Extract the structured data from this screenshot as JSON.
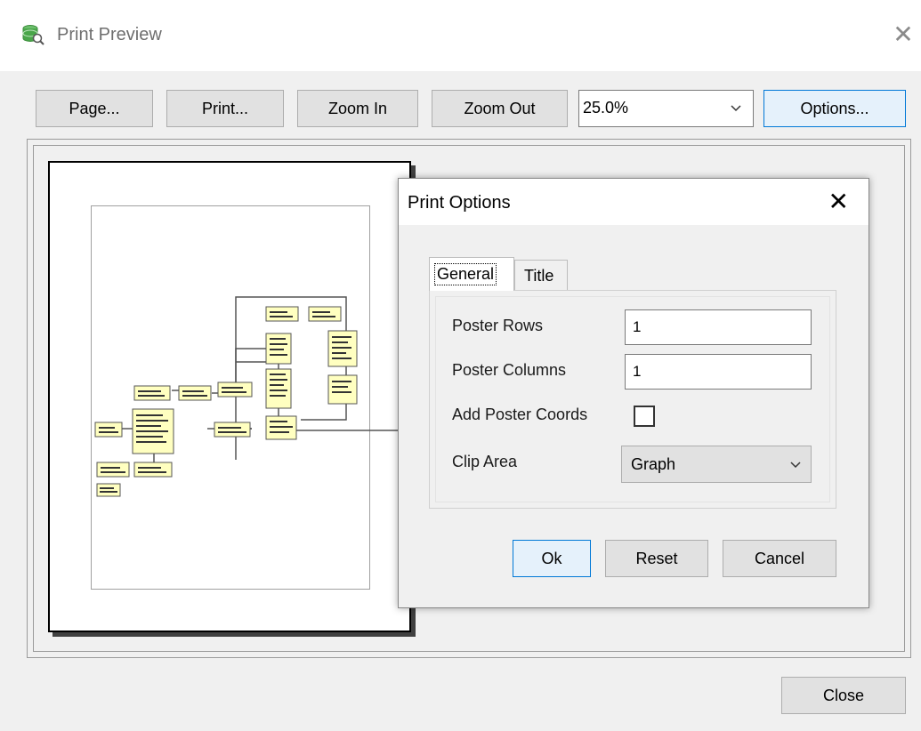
{
  "window": {
    "title": "Print Preview",
    "close_glyph": "✕"
  },
  "toolbar": {
    "page_label": "Page...",
    "print_label": "Print...",
    "zoom_in_label": "Zoom In",
    "zoom_out_label": "Zoom Out",
    "zoom_value": "25.0%",
    "options_label": "Options..."
  },
  "dialog": {
    "title": "Print Options",
    "close_glyph": "✕",
    "tabs": [
      {
        "label": "General",
        "active": true
      },
      {
        "label": "Title",
        "active": false
      }
    ],
    "fields": {
      "poster_rows_label": "Poster Rows",
      "poster_rows_value": "1",
      "poster_columns_label": "Poster Columns",
      "poster_columns_value": "1",
      "add_coords_label": "Add Poster Coords",
      "add_coords_checked": false,
      "clip_area_label": "Clip Area",
      "clip_area_value": "Graph"
    },
    "buttons": {
      "ok_label": "Ok",
      "reset_label": "Reset",
      "cancel_label": "Cancel"
    }
  },
  "footer": {
    "close_label": "Close"
  },
  "icons": {
    "app": "database-search-icon",
    "chevron": "chevron-down-icon"
  },
  "colors": {
    "accent": "#0078d7",
    "node_fill": "#ffffc0",
    "app_icon_green": "#4aa64a"
  }
}
